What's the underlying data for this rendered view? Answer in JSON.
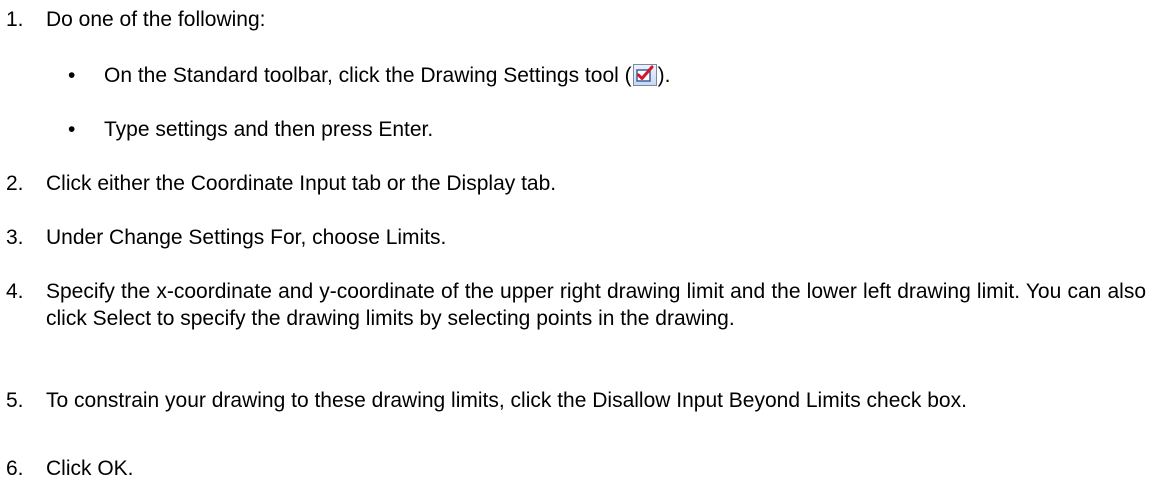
{
  "steps": [
    {
      "number": "1.",
      "text": "Do one of the following:"
    },
    {
      "number": "2.",
      "text": "Click either the Coordinate Input tab or the Display tab."
    },
    {
      "number": "3.",
      "text": "Under Change Settings For, choose Limits."
    },
    {
      "number": "4.",
      "text": "Specify the x-coordinate and y-coordinate of the upper right drawing limit and the lower left drawing limit. You can also click Select to specify the drawing limits by selecting points in the drawing."
    },
    {
      "number": "5.",
      "text": "To constrain your drawing to these drawing limits, click the Disallow Input Beyond Limits check box."
    },
    {
      "number": "6.",
      "text": "Click OK."
    }
  ],
  "bullets": [
    {
      "symbol": "•",
      "text_before": "On the Standard toolbar, click the Drawing Settings tool (",
      "text_after": ").",
      "icon": "drawing-settings-icon"
    },
    {
      "symbol": "•",
      "text": "Type settings and then press Enter."
    }
  ]
}
